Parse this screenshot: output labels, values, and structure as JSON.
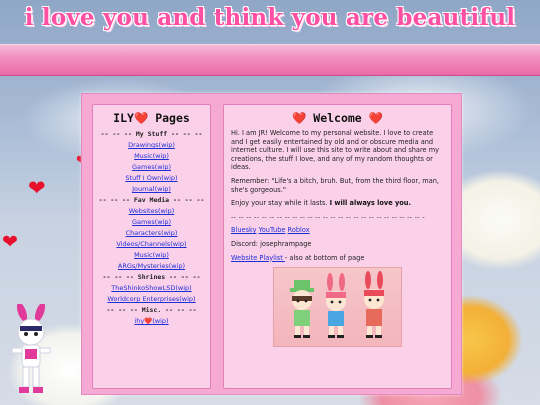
{
  "header": {
    "title": "i love you and think you are beautiful"
  },
  "sidebar": {
    "title_prefix": "ILY",
    "heart": "❤️",
    "title_suffix": " Pages",
    "sections": [
      {
        "label": "-- -- -- My Stuff -- -- --",
        "links": [
          "Drawings(wip)",
          "Music(wip)",
          "Games(wip)",
          "Stuff I Own(wip)",
          "Journal(wip)"
        ]
      },
      {
        "label": "-- -- -- Fav Media -- -- --",
        "links": [
          "Websites(wip)",
          "Games(wip)",
          "Characters(wip)",
          "Videos/Channels(wip)",
          "Music(wip)",
          "ARGs/Mysteries(wip)"
        ]
      },
      {
        "label": "-- -- -- Shrines -- -- --",
        "links": [
          "TheShinkoShowLSD(wip)",
          "Worldcorp Enterprises(wip)"
        ]
      },
      {
        "label": "-- -- -- Misc. -- -- --",
        "links": []
      }
    ],
    "misc_link_prefix": "ihy",
    "misc_link_suffix": "(wip)"
  },
  "main": {
    "heart": "❤️",
    "title": " Welcome ",
    "intro": "Hi. I am JR! Welcome to my personal website. I love to create and I get easily entertained by old and or obscure media and internet culture. I will use this site to write about and share my creations, the stuff I love, and any of my random thoughts or ideas.",
    "remember": "Remember: \"Life's a bitch, bruh. But, from the third floor, man, she's gorgeous.\"",
    "enjoy_prefix": "Enjoy your stay while it lasts. ",
    "enjoy_bold": "I will always love you.",
    "divider": "-- -- -- -- -- -- -- -- -- -- -- -- -- -- -- -- -- -- -- -- -- -- -- -- -- -",
    "social": [
      "Bluesky",
      "YouTube",
      "Roblox"
    ],
    "discord": "Discord: josephrampage",
    "playlist_link": "Website Playlist ",
    "playlist_suffix": "- also at bottom of page"
  },
  "colors": {
    "title_pink": "#ff4fa3",
    "banner_pink": "#f290c0",
    "panel_bg": "#fbd1ea",
    "container_bg": "#f5a9d3",
    "link_blue": "#1f2fd6",
    "heart_red": "#e0102a"
  },
  "icons": [
    "heart-icon",
    "bunny-characters-gif",
    "mascot-character"
  ]
}
